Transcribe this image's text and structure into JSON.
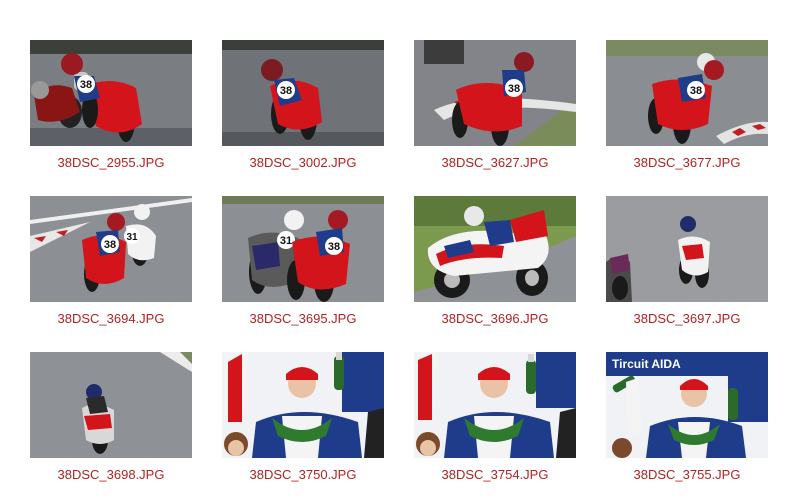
{
  "gallery": {
    "link_color": "#b22222",
    "items": [
      {
        "filename": "38DSC_2955.JPG",
        "scene": "track-two-bikes"
      },
      {
        "filename": "38DSC_3002.JPG",
        "scene": "track-one-bike"
      },
      {
        "filename": "38DSC_3627.JPG",
        "scene": "track-kerb"
      },
      {
        "filename": "38DSC_3677.JPG",
        "scene": "track-kerb-two"
      },
      {
        "filename": "38DSC_3694.JPG",
        "scene": "track-pair"
      },
      {
        "filename": "38DSC_3695.JPG",
        "scene": "track-pair-close"
      },
      {
        "filename": "38DSC_3696.JPG",
        "scene": "track-grass-closeup"
      },
      {
        "filename": "38DSC_3697.JPG",
        "scene": "track-far"
      },
      {
        "filename": "38DSC_3698.JPG",
        "scene": "track-rear"
      },
      {
        "filename": "38DSC_3750.JPG",
        "scene": "podium"
      },
      {
        "filename": "38DSC_3754.JPG",
        "scene": "podium"
      },
      {
        "filename": "38DSC_3755.JPG",
        "scene": "podium-banner"
      }
    ]
  },
  "photo_text": {
    "bike_number": "38",
    "rival_number": "31",
    "banner_text": "Tircuit AIDA"
  }
}
